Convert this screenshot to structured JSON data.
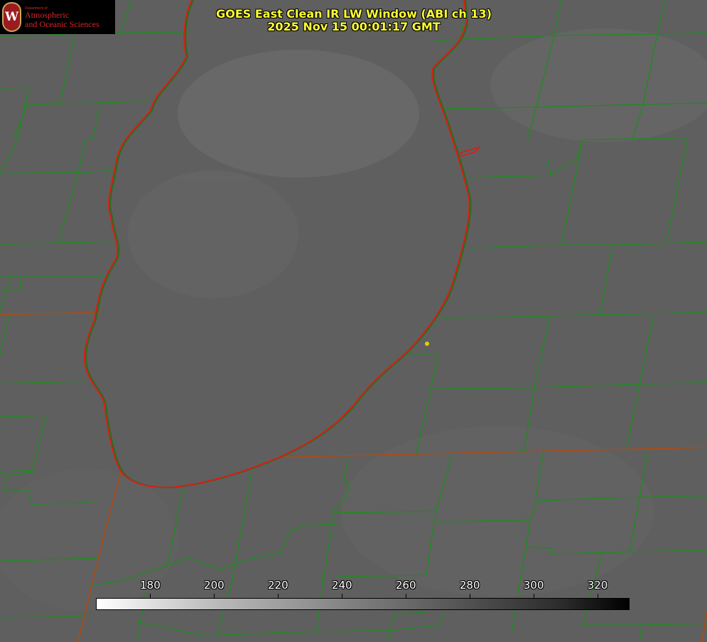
{
  "title": {
    "line1": "GOES East Clean IR LW Window (ABI ch 13)",
    "line2": "2025 Nov 15 00:01:17 GMT"
  },
  "logo": {
    "small_text": "Department of",
    "line1": "Atmospheric",
    "line2": "and Oceanic Sciences",
    "seal_letter": "W"
  },
  "colorbar": {
    "min": 163,
    "max": 330,
    "ticks": [
      "180",
      "200",
      "220",
      "240",
      "260",
      "280",
      "300",
      "320"
    ],
    "tick_values": [
      180,
      200,
      220,
      240,
      260,
      280,
      300,
      320
    ]
  },
  "colors": {
    "background_gray": "#5e5e5e",
    "county_lines": "#1e8c1e",
    "shoreline": "#e11a14",
    "state_lines": "#b04a12",
    "title_text": "#ffff33",
    "station_dot": "#e0d000"
  }
}
